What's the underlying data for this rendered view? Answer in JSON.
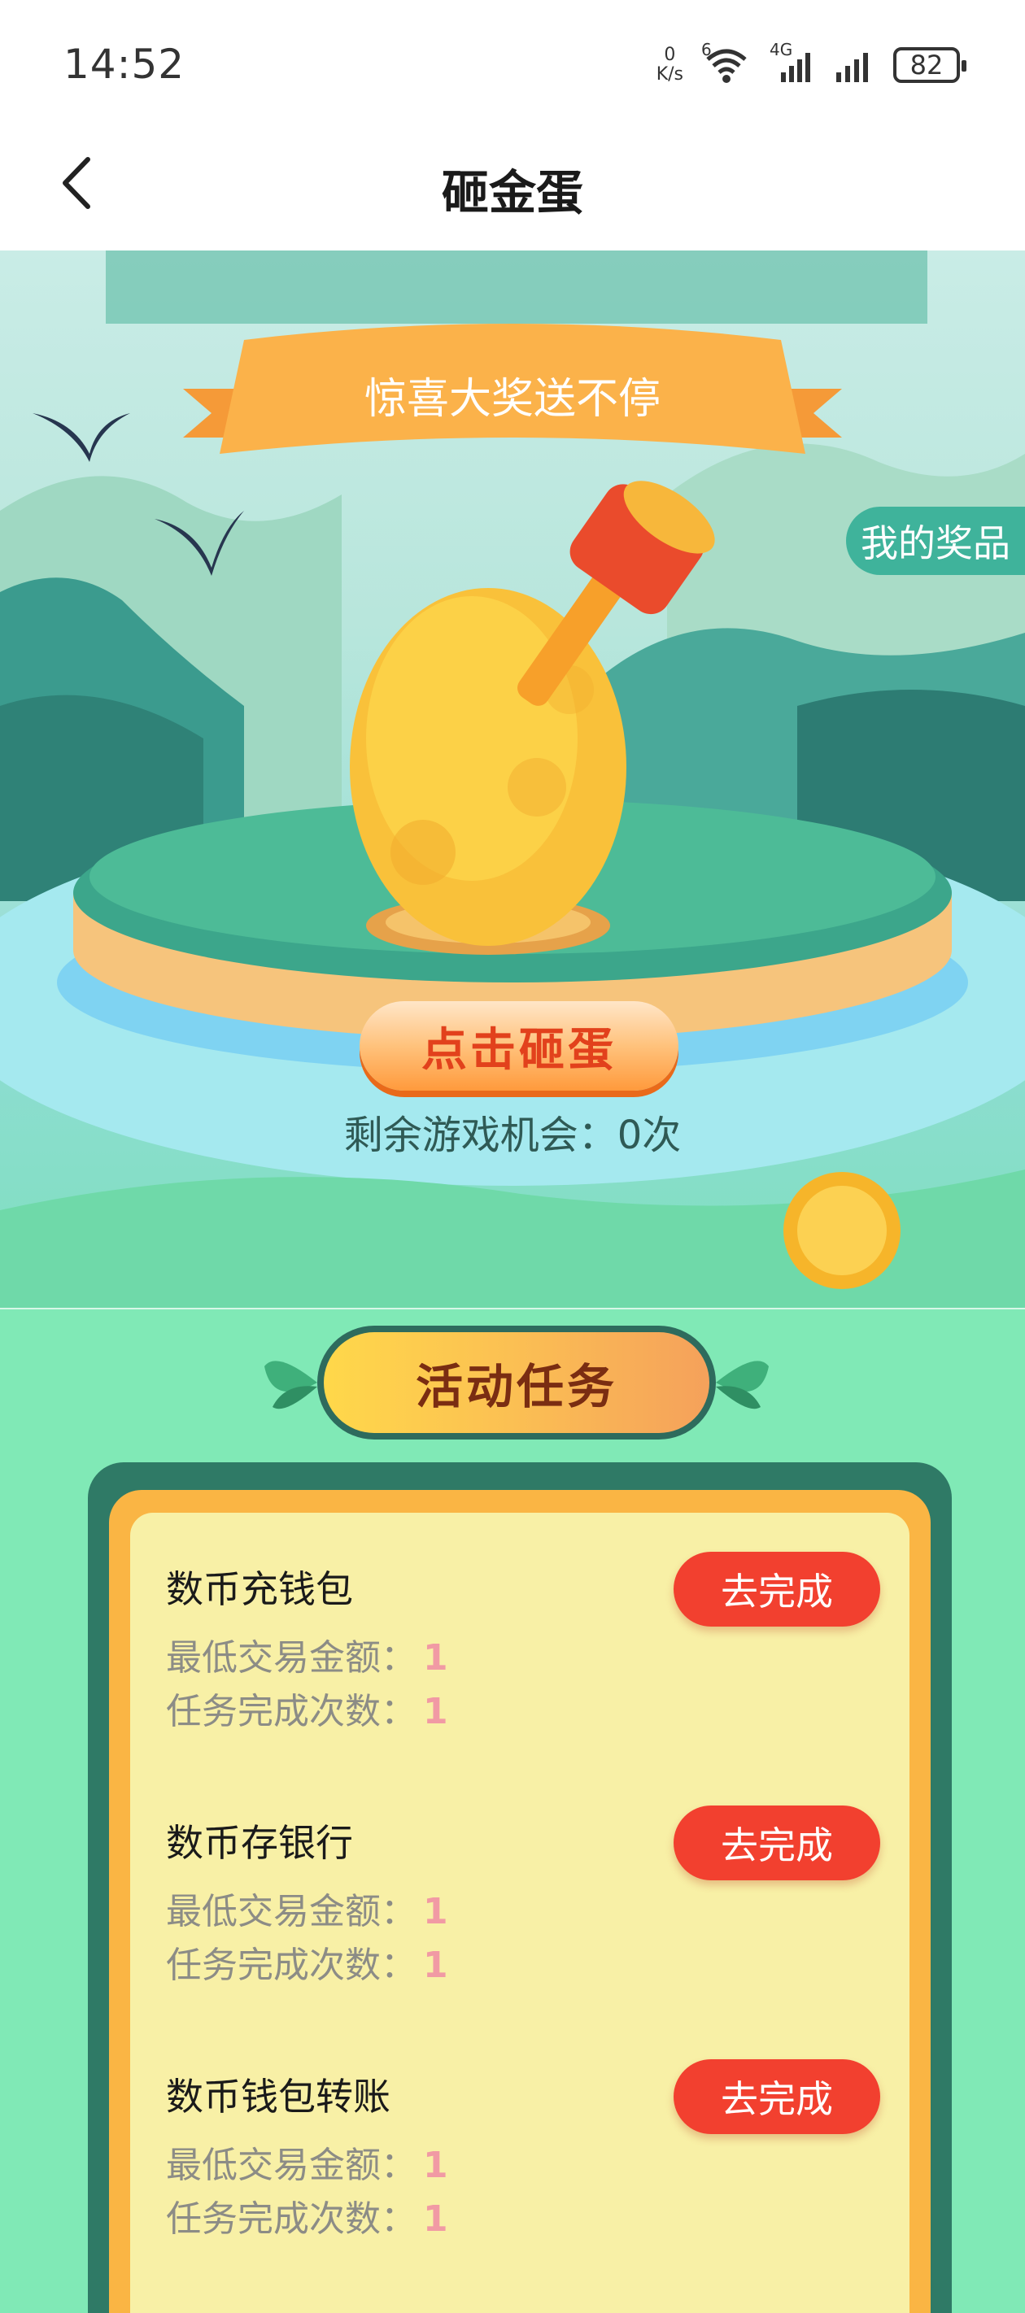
{
  "status_bar": {
    "time": "14:52",
    "net_speed_value": "0",
    "net_speed_unit": "K/s",
    "wifi_badge": "6",
    "cell_badge": "4G",
    "battery": "82"
  },
  "nav": {
    "title": "砸金蛋"
  },
  "hero": {
    "banner": "惊喜大奖送不停",
    "my_prizes": "我的奖品",
    "smash_button": "点击砸蛋",
    "remaining": "剩余游戏机会：0次"
  },
  "tasks": {
    "section_title": "活动任务",
    "items": [
      {
        "name": "数币充钱包",
        "min_amount_label": "最低交易金额：",
        "min_amount_value": "1",
        "count_label": "任务完成次数：",
        "count_value": "1",
        "button": "去完成"
      },
      {
        "name": "数币存银行",
        "min_amount_label": "最低交易金额：",
        "min_amount_value": "1",
        "count_label": "任务完成次数：",
        "count_value": "1",
        "button": "去完成"
      },
      {
        "name": "数币钱包转账",
        "min_amount_label": "最低交易金额：",
        "min_amount_value": "1",
        "count_label": "任务完成次数：",
        "count_value": "1",
        "button": "去完成"
      }
    ]
  }
}
